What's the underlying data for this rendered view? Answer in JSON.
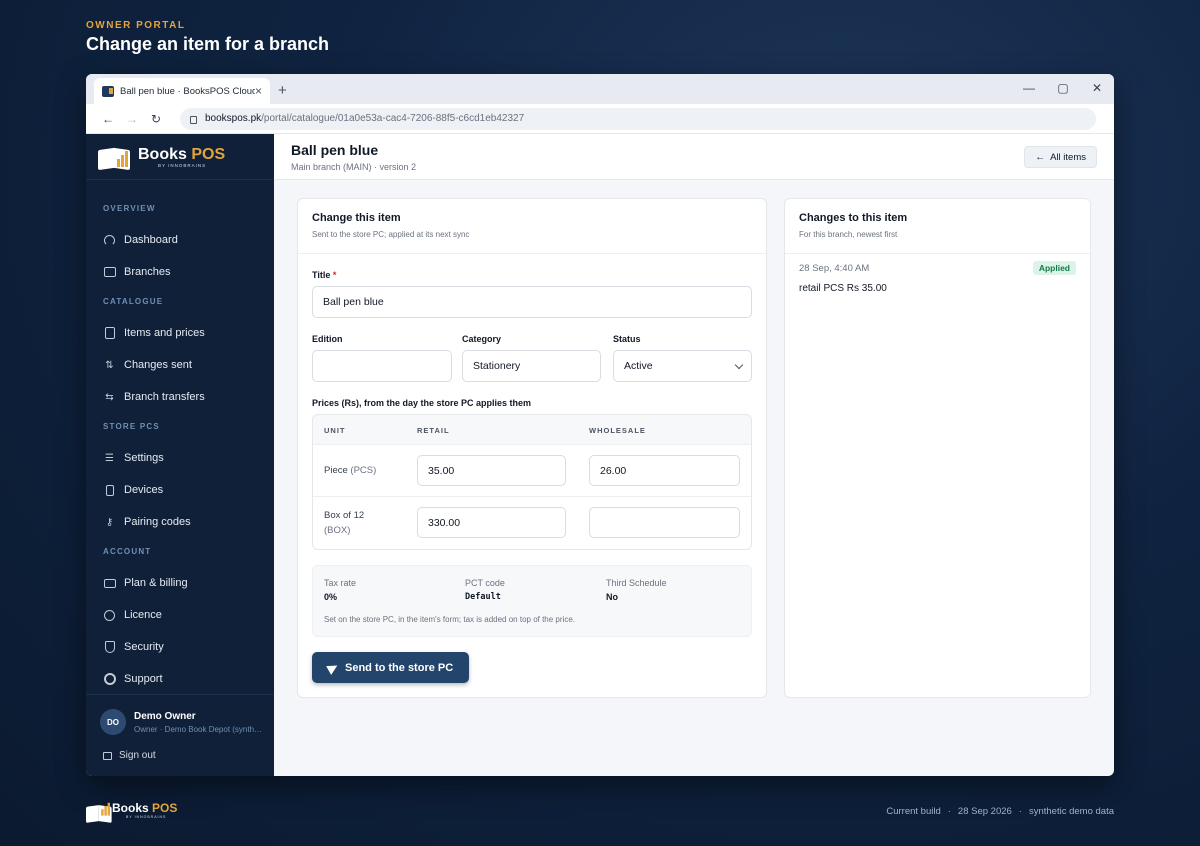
{
  "page": {
    "eyebrow": "OWNER PORTAL",
    "heading": "Change an item for a branch"
  },
  "browser": {
    "tab_title": "Ball pen blue · BooksPOS Cloud",
    "url_host": "bookspos.pk",
    "url_path": "/portal/catalogue/01a0e53a-cac4-7206-88f5-c6cd1eb42327"
  },
  "brand": {
    "name_a": "Books",
    "name_b": "POS",
    "tagline": "BY INNOBRAINS"
  },
  "sidebar": {
    "sections": [
      {
        "title": "OVERVIEW",
        "items": [
          {
            "label": "Dashboard",
            "icon": "gauge-icon"
          },
          {
            "label": "Branches",
            "icon": "store-icon"
          }
        ]
      },
      {
        "title": "CATALOGUE",
        "items": [
          {
            "label": "Items and prices",
            "icon": "book-icon"
          },
          {
            "label": "Changes sent",
            "icon": "up-down-arrows-icon"
          },
          {
            "label": "Branch transfers",
            "icon": "transfer-icon"
          }
        ]
      },
      {
        "title": "STORE PCS",
        "items": [
          {
            "label": "Settings",
            "icon": "sliders-icon"
          },
          {
            "label": "Devices",
            "icon": "devices-icon"
          },
          {
            "label": "Pairing codes",
            "icon": "key-icon"
          }
        ]
      },
      {
        "title": "ACCOUNT",
        "items": [
          {
            "label": "Plan & billing",
            "icon": "credit-card-icon"
          },
          {
            "label": "Licence",
            "icon": "badge-check-icon"
          },
          {
            "label": "Security",
            "icon": "shield-icon"
          },
          {
            "label": "Support",
            "icon": "lifebuoy-icon"
          }
        ]
      }
    ],
    "user": {
      "initials": "DO",
      "name": "Demo Owner",
      "role": "Owner · Demo Book Depot (synthetic demo data)"
    },
    "sign_out": "Sign out"
  },
  "header": {
    "title": "Ball pen blue",
    "subtitle": "Main branch (MAIN) · version 2",
    "all_items": "All items"
  },
  "form": {
    "title": "Change this item",
    "subtitle": "Sent to the store PC; applied at its next sync",
    "title_label": "Title",
    "title_value": "Ball pen blue",
    "edition_label": "Edition",
    "edition_value": "",
    "category_label": "Category",
    "category_value": "Stationery",
    "status_label": "Status",
    "status_value": "Active",
    "prices_label": "Prices (Rs), from the day the store PC applies them",
    "price_columns": [
      "UNIT",
      "RETAIL",
      "WHOLESALE"
    ],
    "price_rows": [
      {
        "unit": "Piece",
        "code": "(PCS)",
        "retail": "35.00",
        "wholesale": "26.00"
      },
      {
        "unit": "Box of 12",
        "code": "(BOX)",
        "retail": "330.00",
        "wholesale": ""
      }
    ],
    "tax": {
      "rate_label": "Tax rate",
      "rate_value": "0%",
      "pct_label": "PCT code",
      "pct_value": "Default",
      "schedule_label": "Third Schedule",
      "schedule_value": "No",
      "note": "Set on the store PC, in the item's form; tax is added on top of the price."
    },
    "send_label": "Send to the store PC"
  },
  "changes": {
    "title": "Changes to this item",
    "subtitle": "For this branch, newest first",
    "entries": [
      {
        "time": "28 Sep, 4:40 AM",
        "status": "Applied",
        "description": "retail PCS Rs 35.00"
      }
    ]
  },
  "footer": {
    "build_label": "Current build",
    "build_date": "28 Sep 2026",
    "note": "synthetic demo data"
  },
  "colors": {
    "accent": "#e2a43b",
    "sidebar_bg": "#0f2038",
    "primary_button": "#23456c",
    "applied_badge_bg": "#dcf3e7",
    "applied_badge_text": "#137a4b"
  }
}
